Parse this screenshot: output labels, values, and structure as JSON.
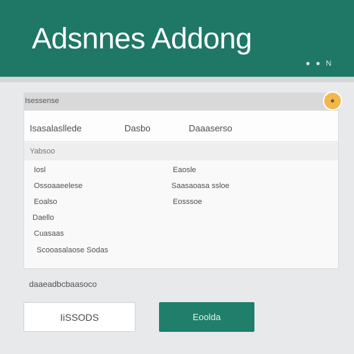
{
  "header": {
    "title": "Adsnnes Addong",
    "icons": [
      "circle-icon",
      "circle-icon",
      "n-icon"
    ],
    "icon_glyphs": [
      "●",
      "●",
      "N"
    ]
  },
  "toolbar": {
    "label": "Isessense",
    "button_glyph": "●"
  },
  "table": {
    "columns": [
      "Isasalasllede",
      "Dasbo",
      "Daaaserso"
    ],
    "subheader": "Yabsoo",
    "rows_left": [
      "Iosl",
      "Ossoaaeelese",
      "Eoalso",
      "Daello",
      "Cuasaas",
      "Scooasalaose Sodas"
    ],
    "rows_right": [
      "Eaosle",
      "Saasaoasa ssloe",
      "Eosssoe"
    ]
  },
  "section": {
    "label": "daaeadbcbaasoco"
  },
  "buttons": {
    "secondary": "IiSSODS",
    "primary": "Eoolda"
  },
  "colors": {
    "header_bg": "#1f7766",
    "primary_button": "#1f7f6a",
    "accent_button": "#f2b84b"
  }
}
